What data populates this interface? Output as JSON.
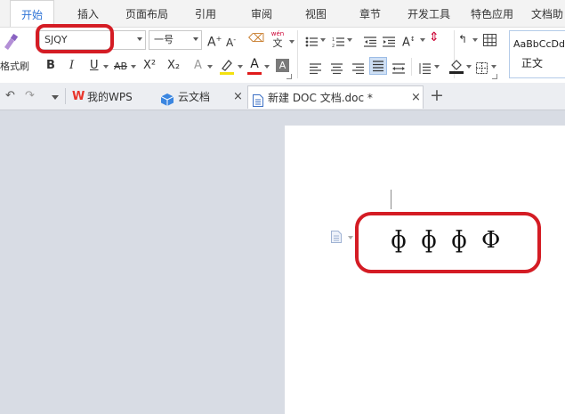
{
  "menu": {
    "tabs": [
      "开始",
      "插入",
      "页面布局",
      "引用",
      "审阅",
      "视图",
      "章节",
      "开发工具",
      "特色应用",
      "文档助"
    ],
    "active_index": 0
  },
  "ribbon": {
    "format_painter_label": "格式刷",
    "font_name": "SJQY",
    "font_size": "一号",
    "bold": "B",
    "italic": "I",
    "underline": "U",
    "strike": "AB",
    "superscript": "X²",
    "subscript": "X₂",
    "font_color": "A",
    "style_preview": "AaBbCcDd",
    "style_name": "正文",
    "phonetic_top": "wén",
    "phonetic_bottom": "文"
  },
  "doc_tabs": [
    {
      "label": "我的WPS"
    },
    {
      "label": "云文档"
    },
    {
      "label": "新建 DOC 文档.doc *"
    }
  ],
  "document": {
    "glyphs": [
      "ɸ",
      "ɸ",
      "ɸ",
      "Φ"
    ]
  },
  "colors": {
    "accent": "#2f74d6",
    "highlight_box": "#d41c24",
    "wps_logo": "#e8342a",
    "cloud_icon": "#3b86e0"
  }
}
